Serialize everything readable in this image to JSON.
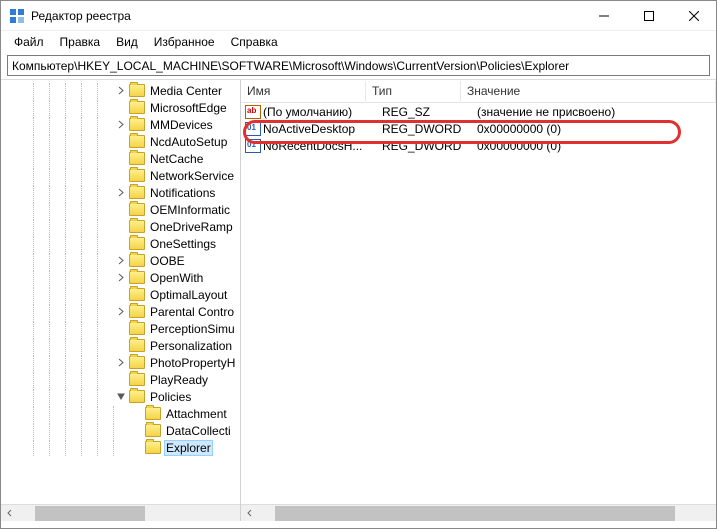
{
  "window": {
    "title": "Редактор реестра"
  },
  "menu": {
    "file": "Файл",
    "edit": "Правка",
    "view": "Вид",
    "fav": "Избранное",
    "help": "Справка"
  },
  "address": {
    "value": "Компьютер\\HKEY_LOCAL_MACHINE\\SOFTWARE\\Microsoft\\Windows\\CurrentVersion\\Policies\\Explorer"
  },
  "tree": {
    "items": [
      {
        "d": 7,
        "g": "r",
        "l": "Media Center"
      },
      {
        "d": 7,
        "g": "",
        "l": "MicrosoftEdge"
      },
      {
        "d": 7,
        "g": "r",
        "l": "MMDevices"
      },
      {
        "d": 7,
        "g": "",
        "l": "NcdAutoSetup"
      },
      {
        "d": 7,
        "g": "",
        "l": "NetCache"
      },
      {
        "d": 7,
        "g": "",
        "l": "NetworkService"
      },
      {
        "d": 7,
        "g": "r",
        "l": "Notifications"
      },
      {
        "d": 7,
        "g": "",
        "l": "OEMInformatic"
      },
      {
        "d": 7,
        "g": "",
        "l": "OneDriveRamp"
      },
      {
        "d": 7,
        "g": "",
        "l": "OneSettings"
      },
      {
        "d": 7,
        "g": "r",
        "l": "OOBE"
      },
      {
        "d": 7,
        "g": "r",
        "l": "OpenWith"
      },
      {
        "d": 7,
        "g": "",
        "l": "OptimalLayout"
      },
      {
        "d": 7,
        "g": "r",
        "l": "Parental Contro"
      },
      {
        "d": 7,
        "g": "",
        "l": "PerceptionSimu"
      },
      {
        "d": 7,
        "g": "",
        "l": "Personalization"
      },
      {
        "d": 7,
        "g": "r",
        "l": "PhotoPropertyH"
      },
      {
        "d": 7,
        "g": "",
        "l": "PlayReady"
      },
      {
        "d": 7,
        "g": "d",
        "l": "Policies"
      },
      {
        "d": 8,
        "g": "",
        "l": "Attachment"
      },
      {
        "d": 8,
        "g": "",
        "l": "DataCollecti"
      },
      {
        "d": 8,
        "g": "",
        "l": "Explorer",
        "sel": true
      }
    ]
  },
  "list": {
    "hdr": {
      "name": "Имя",
      "type": "Тип",
      "value": "Значение"
    },
    "rows": [
      {
        "icon": "ab",
        "n": "(По умолчанию)",
        "t": "REG_SZ",
        "v": "(значение не присвоено)"
      },
      {
        "icon": "dw",
        "n": "NoActiveDesktop",
        "t": "REG_DWORD",
        "v": "0x00000000 (0)"
      },
      {
        "icon": "dw",
        "n": "NoRecentDocsH...",
        "t": "REG_DWORD",
        "v": "0x00000000 (0)"
      }
    ]
  }
}
